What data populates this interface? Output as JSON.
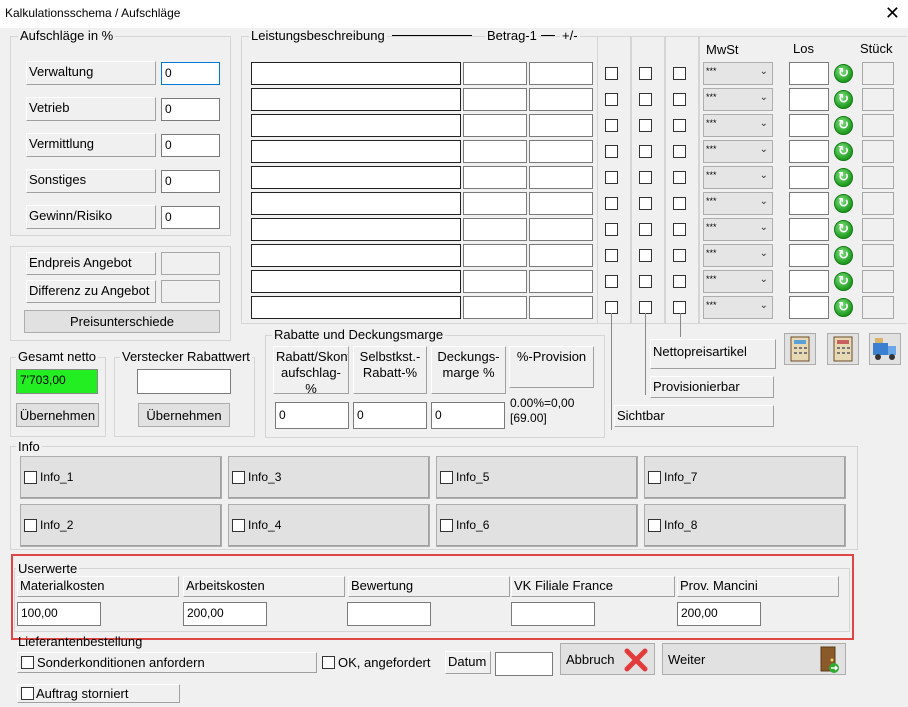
{
  "window": {
    "title": "Kalkulationsschema / Aufschläge",
    "close_glyph": "✕"
  },
  "aufschlaege": {
    "title": "Aufschläge in %",
    "rows": [
      {
        "label": "Verwaltung",
        "value": "0"
      },
      {
        "label": "Vetrieb",
        "value": "0"
      },
      {
        "label": "Vermittlung",
        "value": "0"
      },
      {
        "label": "Sonstiges",
        "value": "0"
      },
      {
        "label": "Gewinn/Risiko",
        "value": "0"
      }
    ]
  },
  "endpreis": {
    "endpreis_label": "Endpreis Angebot",
    "differenz_label": "Differenz zu Angebot",
    "preisunterschiede_button": "Preisunterschiede"
  },
  "gesamt": {
    "label": "Gesamt netto",
    "value": "7'703,00",
    "button": "Übernehmen"
  },
  "rabattwert": {
    "label": "Verstecker Rabattwert",
    "value": "",
    "button": "Übernehmen"
  },
  "leistung": {
    "header_desc": "Leistungsbeschreibung",
    "header_betrag": "Betrag-1",
    "header_plusminus": "+/-",
    "header_mwst": "MwSt",
    "header_los": "Los",
    "header_stueck": "Stück",
    "combo_value": "***",
    "row_count": 10
  },
  "rabatte": {
    "title": "Rabatte und Deckungsmarge",
    "col1": "Rabatt/Skont aufschlag-%",
    "col2": "Selbstkst.-Rabatt-%",
    "col3": "Deckungs-marge %",
    "col4": "%-Provision",
    "v1": "0",
    "v2": "0",
    "v3": "0",
    "provision_text": "0.00%=0,00 [69.00]"
  },
  "flags": {
    "nettopreisartikel": "Nettopreisartikel",
    "provisionierbar": "Provisionierbar",
    "sichtbar": "Sichtbar"
  },
  "info": {
    "title": "Info",
    "items": [
      "Info_1",
      "Info_3",
      "Info_5",
      "Info_7",
      "Info_2",
      "Info_4",
      "Info_6",
      "Info_8"
    ]
  },
  "userwerte": {
    "title": "Userwerte",
    "fields": [
      {
        "label": "Materialkosten",
        "value": "100,00"
      },
      {
        "label": "Arbeitskosten",
        "value": "200,00"
      },
      {
        "label": "Bewertung",
        "value": ""
      },
      {
        "label": "VK Filiale France",
        "value": ""
      },
      {
        "label": "Prov. Mancini",
        "value": "200,00"
      }
    ]
  },
  "lieferanten": {
    "title": "Lieferantenbestellung",
    "sonderkonditionen": "Sonderkonditionen anfordern",
    "ok_angefordert": "OK, angefordert",
    "datum_label": "Datum",
    "datum_value": ""
  },
  "actions": {
    "abbruch": "Abbruch",
    "weiter": "Weiter"
  },
  "auftrag": {
    "storniert": "Auftrag storniert"
  },
  "colors": {
    "gesamt_bg": "#22ee22",
    "highlight_border": "#e04545",
    "cancel_red": "#e23b3b"
  },
  "icons": [
    "close-icon",
    "refresh-icon",
    "cancel-x-icon",
    "exit-door-icon",
    "calculator-icon",
    "truck-icon"
  ]
}
